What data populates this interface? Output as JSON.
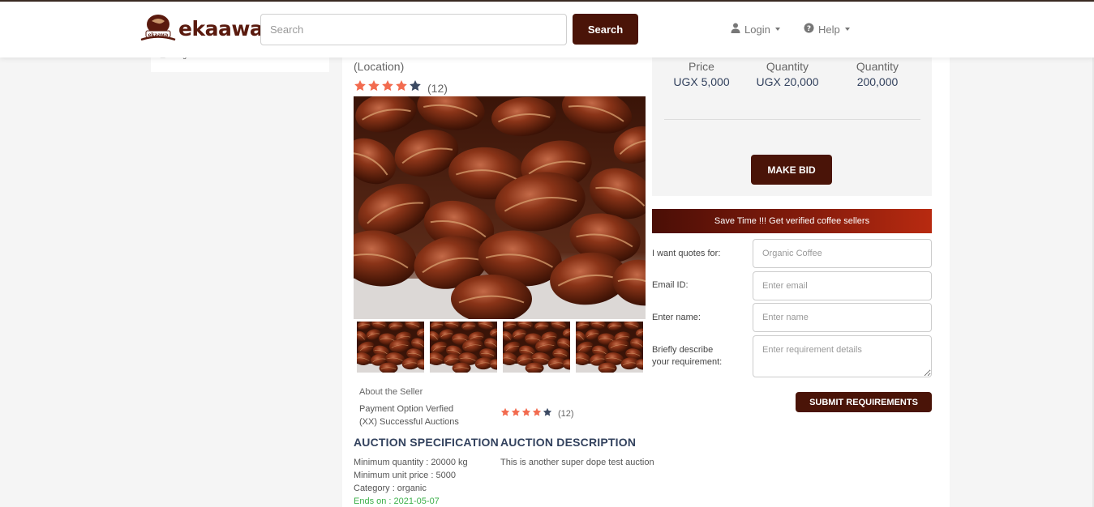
{
  "header": {
    "brand": "ekaawa",
    "search_placeholder": "Search",
    "search_button": "Search",
    "login_label": "Login",
    "help_label": "Help"
  },
  "sidebar": {
    "partial_text": "g"
  },
  "listing": {
    "location": "(Location)",
    "rating_stars": 4,
    "rating_count": "(12)",
    "about_title": "About the Seller",
    "payment_option": "Payment Option Verfied",
    "auctions": "(XX) Successful Auctions",
    "seller_rating_stars": 4,
    "seller_rating_count": "(12)",
    "spec_heading": "AUCTION SPECIFICATION",
    "min_qty": "Minimum quantity : 20000 kg",
    "min_price": "Minimum unit price : 5000",
    "category": "Category : organic",
    "ends_on": "Ends on : 2021-05-07",
    "desc_heading": "AUCTION DESCRIPTION",
    "description": "This is another super dope test auction"
  },
  "bid": {
    "columns": [
      {
        "label": "Price",
        "value": "UGX 5,000"
      },
      {
        "label": "Quantity",
        "value": "UGX 20,000"
      },
      {
        "label": "Quantity",
        "value": "200,000"
      }
    ],
    "make_bid_label": "MAKE BID"
  },
  "quote_form": {
    "banner": "Save Time !!! Get verified coffee sellers",
    "quotes_label": "I want quotes for:",
    "quotes_placeholder": "Organic Coffee",
    "email_label": "Email ID:",
    "email_placeholder": "Enter email",
    "name_label": "Enter name:",
    "name_placeholder": "Enter name",
    "req_label_1": "Briefly describe",
    "req_label_2": "your requirement:",
    "req_placeholder": "Enter requirement details",
    "submit_label": "SUBMIT REQUIREMENTS"
  },
  "colors": {
    "brand": "#4a1408",
    "star_filled": "#f26b4f",
    "star_empty": "#3c4a63",
    "heading": "#33425e",
    "ends_green": "#3cb04a"
  },
  "icons": {
    "login": "user-icon",
    "help": "question-circle-icon"
  }
}
